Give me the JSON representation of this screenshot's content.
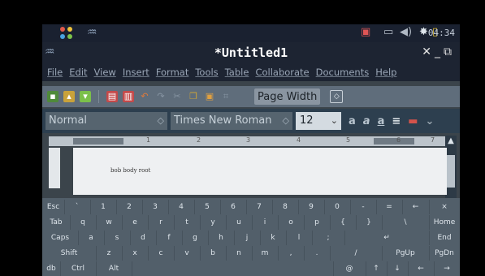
{
  "panel": {
    "clock": "04:34"
  },
  "window": {
    "title": "*Untitled1"
  },
  "menu": [
    "File",
    "Edit",
    "View",
    "Insert",
    "Format",
    "Tools",
    "Table",
    "Collaborate",
    "Documents",
    "Help"
  ],
  "toolbar": {
    "zoom_value": "Page Width"
  },
  "format": {
    "style": "Normal",
    "font": "Times New Roman",
    "size": "12"
  },
  "ruler": {
    "numbers": [
      "1",
      "2",
      "3",
      "4",
      "5",
      "6",
      "7"
    ]
  },
  "document": {
    "text": "bob body root"
  },
  "keyboard": {
    "rows": [
      [
        "Esc",
        "`",
        "1",
        "2",
        "3",
        "4",
        "5",
        "6",
        "7",
        "8",
        "9",
        "0",
        "-",
        "=",
        "←",
        "⨯"
      ],
      [
        "Tab",
        "q",
        "w",
        "e",
        "r",
        "t",
        "y",
        "u",
        "i",
        "o",
        "p",
        "{",
        "}",
        "\\",
        "Home"
      ],
      [
        "Caps",
        "a",
        "s",
        "d",
        "f",
        "g",
        "h",
        "j",
        "k",
        "l",
        ";",
        "↵",
        "End"
      ],
      [
        "Shift",
        "z",
        "x",
        "c",
        "v",
        "b",
        "n",
        "m",
        ",",
        ".",
        "/",
        "PgUp",
        "PgDn"
      ],
      [
        "db",
        "Ctrl",
        "Alt",
        "@",
        "↑",
        "↓",
        "←",
        "→"
      ]
    ]
  },
  "colors": {
    "window_bg": "#3b444b",
    "title_bar": "#1d2432",
    "toolbar": "#5f6d7b",
    "format_bar": "#2d3f4f",
    "page": "#eef0f2",
    "keyboard": "#525f6a"
  }
}
